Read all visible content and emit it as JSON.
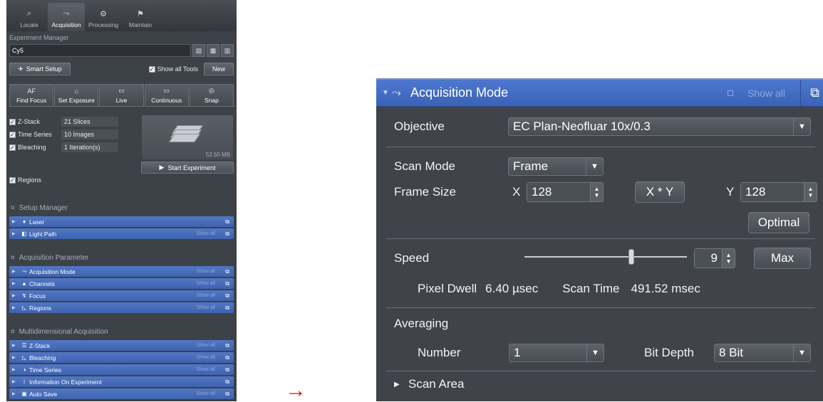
{
  "tabs": [
    {
      "label": "Locate",
      "icon": "locate-icon",
      "glyph": "⌕"
    },
    {
      "label": "Acquisition",
      "icon": "acquisition-icon",
      "glyph": "⤳"
    },
    {
      "label": "Processing",
      "icon": "processing-icon",
      "glyph": "⚙"
    },
    {
      "label": "Maintain",
      "icon": "maintain-icon",
      "glyph": "⚑"
    }
  ],
  "experiment": {
    "section_label": "Experiment Manager",
    "name": "Cy5",
    "smart_setup": "Smart Setup",
    "show_all_tools": "Show all Tools",
    "new_label": "New"
  },
  "toolbar": [
    {
      "icon_text": "AF",
      "label": "Find Focus",
      "icon": "autofocus-icon"
    },
    {
      "icon_text": "⌂",
      "label": "Set Exposure",
      "icon": "exposure-icon"
    },
    {
      "icon_text": "▭",
      "label": "Live",
      "icon": "live-icon"
    },
    {
      "icon_text": "▭",
      "label": "Continuous",
      "icon": "continuous-icon"
    },
    {
      "icon_text": "◎",
      "label": "Snap",
      "icon": "snap-icon"
    }
  ],
  "dimensions": [
    {
      "label": "Z-Stack",
      "value": "21 Slices"
    },
    {
      "label": "Time Series",
      "value": "10 Images"
    },
    {
      "label": "Bleaching",
      "value": "1 Iteration(s)"
    }
  ],
  "regions_label": "Regions",
  "stack_size": "52.50 MB",
  "start_experiment": "Start Experiment",
  "groups": {
    "setup": {
      "title": "Setup Manager",
      "items": [
        {
          "label": "Laser",
          "glyph": "♦",
          "show_all": ""
        },
        {
          "label": "Light Path",
          "glyph": "◧",
          "show_all": "Show all"
        }
      ]
    },
    "acq": {
      "title": "Acquisition Parameter",
      "items": [
        {
          "label": "Acquisition Mode",
          "glyph": "⤳",
          "show_all": "Show all"
        },
        {
          "label": "Channels",
          "glyph": "▲",
          "show_all": "Show all"
        },
        {
          "label": "Focus",
          "glyph": "↯",
          "show_all": "Show all"
        },
        {
          "label": "Regions",
          "glyph": "◺",
          "show_all": "Show all"
        }
      ]
    },
    "multi": {
      "title": "Multidimensional Acquisition",
      "items": [
        {
          "label": "Z-Stack",
          "glyph": "☰",
          "show_all": "Show all"
        },
        {
          "label": "Bleaching",
          "glyph": "◺",
          "show_all": "Show all"
        },
        {
          "label": "Time Series",
          "glyph": "◑",
          "show_all": "Show all"
        },
        {
          "label": "Information On Experiment",
          "glyph": "i",
          "show_all": ""
        },
        {
          "label": "Auto Save",
          "glyph": "▣",
          "show_all": "Show all"
        }
      ]
    }
  },
  "arrow": "→",
  "acq_mode": {
    "title": "Acquisition Mode",
    "show_all": "Show all",
    "objective_label": "Objective",
    "objective_value": "EC Plan-Neofluar 10x/0.3",
    "scan_mode_label": "Scan Mode",
    "scan_mode_value": "Frame",
    "frame_size_label": "Frame Size",
    "x_label": "X",
    "x_value": "128",
    "xy_label": "X * Y",
    "y_label": "Y",
    "y_value": "128",
    "optimal_label": "Optimal",
    "speed_label": "Speed",
    "speed_value": "9",
    "speed_level_fraction": 0.66,
    "max_label": "Max",
    "pixel_dwell_label": "Pixel Dwell",
    "pixel_dwell_value": "6.40 µsec",
    "scan_time_label": "Scan Time",
    "scan_time_value": "491.52 msec",
    "averaging_label": "Averaging",
    "number_label": "Number",
    "number_value": "1",
    "bit_depth_label": "Bit Depth",
    "bit_depth_value": "8 Bit",
    "scan_area_label": "Scan Area"
  },
  "colors": {
    "panel_bg": "#3d4148",
    "header_blue": "#4a72c8",
    "arrow_red": "#e01010"
  }
}
